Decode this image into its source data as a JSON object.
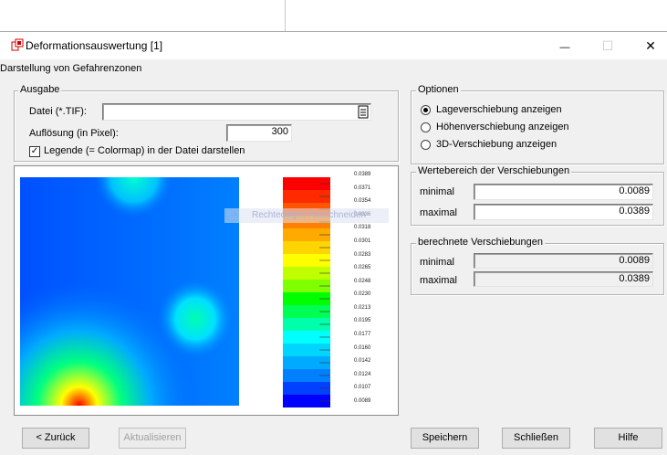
{
  "window": {
    "title": "Deformationsauswertung [1]",
    "subtitle": "Darstellung von Gefahrenzonen",
    "minimize_glyph": "—",
    "maximize_glyph": "☐",
    "close_glyph": "✕"
  },
  "ausgabe": {
    "legend": "Ausgabe",
    "file_label": "Datei (*.TIF):",
    "file_value": "",
    "resolution_label": "Auflösung (in Pixel):",
    "resolution_value": "300",
    "legend_checkbox_label": "Legende (= Colormap) in der Datei darstellen",
    "legend_checkbox_checked": true
  },
  "optionen": {
    "legend": "Optionen",
    "options": [
      {
        "label": "Lageverschiebung anzeigen",
        "selected": true
      },
      {
        "label": "Höhenverschiebung anzeigen",
        "selected": false
      },
      {
        "label": "3D-Verschiebung anzeigen",
        "selected": false
      }
    ]
  },
  "wertebereich": {
    "legend": "Wertebereich der Verschiebungen",
    "min_label": "minimal",
    "min_value": "0.0089",
    "max_label": "maximal",
    "max_value": "0.0389"
  },
  "berechnet": {
    "legend": "berechnete Verschiebungen",
    "min_label": "minimal",
    "min_value": "0.0089",
    "max_label": "maximal",
    "max_value": "0.0389"
  },
  "colormap": {
    "ticks": [
      "0.0389",
      "0.0371",
      "0.0354",
      "0.0336",
      "0.0318",
      "0.0301",
      "0.0283",
      "0.0265",
      "0.0248",
      "0.0230",
      "0.0213",
      "0.0195",
      "0.0177",
      "0.0160",
      "0.0142",
      "0.0124",
      "0.0107",
      "0.0089"
    ],
    "colors": [
      "#ff0000",
      "#ff2a00",
      "#ff5500",
      "#ff8000",
      "#ffaa00",
      "#ffd500",
      "#ffff00",
      "#bfff00",
      "#80ff00",
      "#00ff00",
      "#00ff55",
      "#00ffaa",
      "#00ffff",
      "#00d5ff",
      "#00aaff",
      "#0080ff",
      "#0040ff",
      "#0000ff"
    ]
  },
  "tooltip": "Rechteckiges Ausschneiden",
  "buttons": {
    "back": "< Zurück",
    "refresh": "Aktualisieren",
    "save": "Speichern",
    "close": "Schließen",
    "help": "Hilfe"
  }
}
